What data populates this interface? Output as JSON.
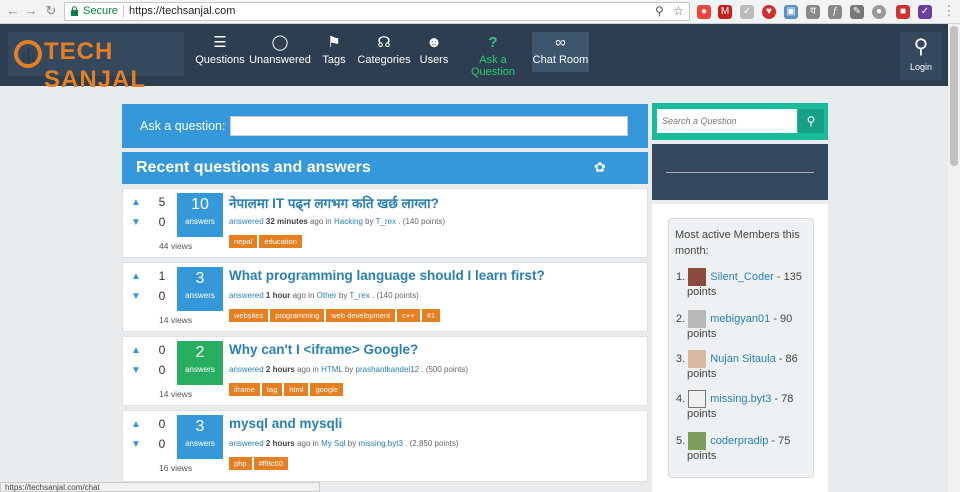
{
  "browser": {
    "secure_label": "Secure",
    "url": "https://techsanjal.com",
    "status_url": "https://techsanjal.com/chat"
  },
  "logo": {
    "text": "TECH SANJAL"
  },
  "nav": [
    {
      "label": "Questions",
      "icon": "list-icon"
    },
    {
      "label": "Unanswered",
      "icon": "shield-icon"
    },
    {
      "label": "Tags",
      "icon": "tag-icon"
    },
    {
      "label": "Categories",
      "icon": "sitemap-icon"
    },
    {
      "label": "Users",
      "icon": "users-icon"
    },
    {
      "label": "Ask a Question",
      "icon": "question-icon"
    },
    {
      "label": "Chat Room",
      "icon": "infinity-icon"
    }
  ],
  "login": {
    "label": "Login"
  },
  "ask": {
    "label": "Ask a question:"
  },
  "recent": {
    "title": "Recent questions and answers"
  },
  "questions": [
    {
      "up": "5",
      "down": "0",
      "answers": "10",
      "answers_label": "answers",
      "views": "44 views",
      "title": "नेपालमा IT पढ्न लगभग कति खर्छ लाग्ला?",
      "verb": "answered",
      "time": "32 minutes",
      "ago": "ago in",
      "category": "Hacking",
      "by": "by",
      "user": "T_rex",
      "points": ". (140 points)",
      "tags": [
        "nepal",
        "education"
      ]
    },
    {
      "up": "1",
      "down": "0",
      "answers": "3",
      "answers_label": "answers",
      "views": "14 views",
      "title": "What programming language should I learn first?",
      "verb": "answered",
      "time": "1 hour",
      "ago": "ago in",
      "category": "Other",
      "by": "by",
      "user": "T_rex",
      "points": ". (140 points)",
      "tags": [
        "websites",
        "programming",
        "web development",
        "c++",
        "#1"
      ]
    },
    {
      "up": "0",
      "down": "0",
      "answers": "2",
      "answers_label": "answers",
      "views": "14 views",
      "title": "Why can't I <iframe> Google?",
      "verb": "answered",
      "time": "2 hours",
      "ago": "ago in",
      "category": "HTML",
      "by": "by",
      "user": "prashantkandel12",
      "points": ". (500 points)",
      "tags": [
        "iframe",
        "tag",
        "html",
        "google"
      ]
    },
    {
      "up": "0",
      "down": "0",
      "answers": "3",
      "answers_label": "answers",
      "views": "16 views",
      "title": "mysql and mysqli",
      "verb": "answered",
      "time": "2 hours",
      "ago": "ago in",
      "category": "My Sql",
      "by": "by",
      "user": "missing.byt3",
      "points": ". (2,850 points)",
      "tags": [
        "php",
        "#ff8c00"
      ]
    }
  ],
  "search": {
    "placeholder": "Search a Question"
  },
  "members": {
    "title": "Most active Members this month:",
    "list": [
      {
        "num": "1.",
        "name": "Silent_Coder",
        "score": "- 135",
        "unit": "points"
      },
      {
        "num": "2.",
        "name": "mebigyan01",
        "score": "- 90",
        "unit": "points"
      },
      {
        "num": "3.",
        "name": "Nujan Sitaula",
        "score": "- 86",
        "unit": "points"
      },
      {
        "num": "4.",
        "name": "missing.byt3",
        "score": "- 78",
        "unit": "points"
      },
      {
        "num": "5.",
        "name": "coderpradip",
        "score": "- 75",
        "unit": "points"
      }
    ]
  },
  "colors": {
    "brand_orange": "#e67e22",
    "blue": "#3498db",
    "green": "#27ae60",
    "teal": "#1abc9c",
    "dark": "#2c3e50"
  }
}
